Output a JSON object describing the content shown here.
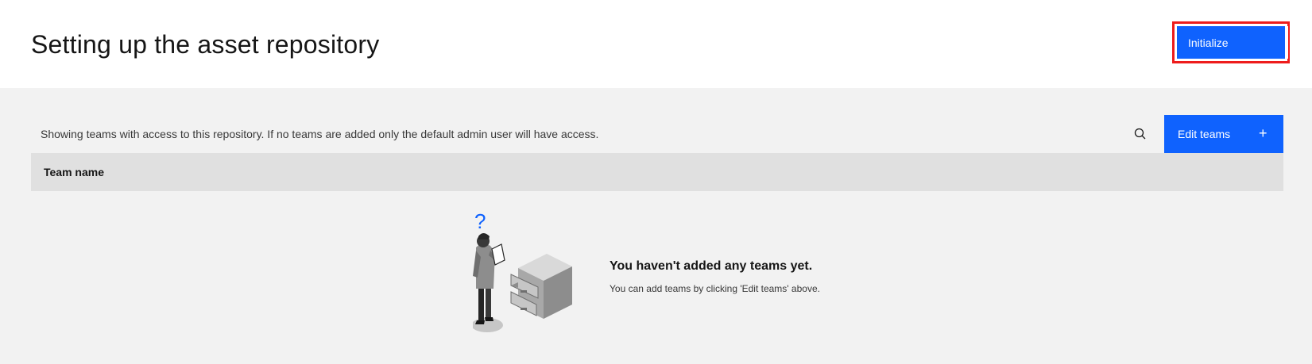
{
  "header": {
    "title": "Setting up the asset repository",
    "initialize_label": "Initialize"
  },
  "toolbar": {
    "description": "Showing teams with access to this repository. If no teams are added only the default admin user will have access.",
    "search_icon": "search-icon",
    "edit_teams_label": "Edit teams",
    "plus_icon": "+"
  },
  "table": {
    "columns": [
      "Team name"
    ]
  },
  "empty_state": {
    "question_mark": "?",
    "title": "You haven't added any teams yet.",
    "subtitle": "You can add teams by clicking 'Edit teams' above."
  },
  "colors": {
    "primary": "#0f62fe",
    "highlight_border": "#ee1c1c",
    "header_bg": "#ffffff",
    "page_bg": "#f2f2f2",
    "table_header_bg": "#e0e0e0"
  }
}
